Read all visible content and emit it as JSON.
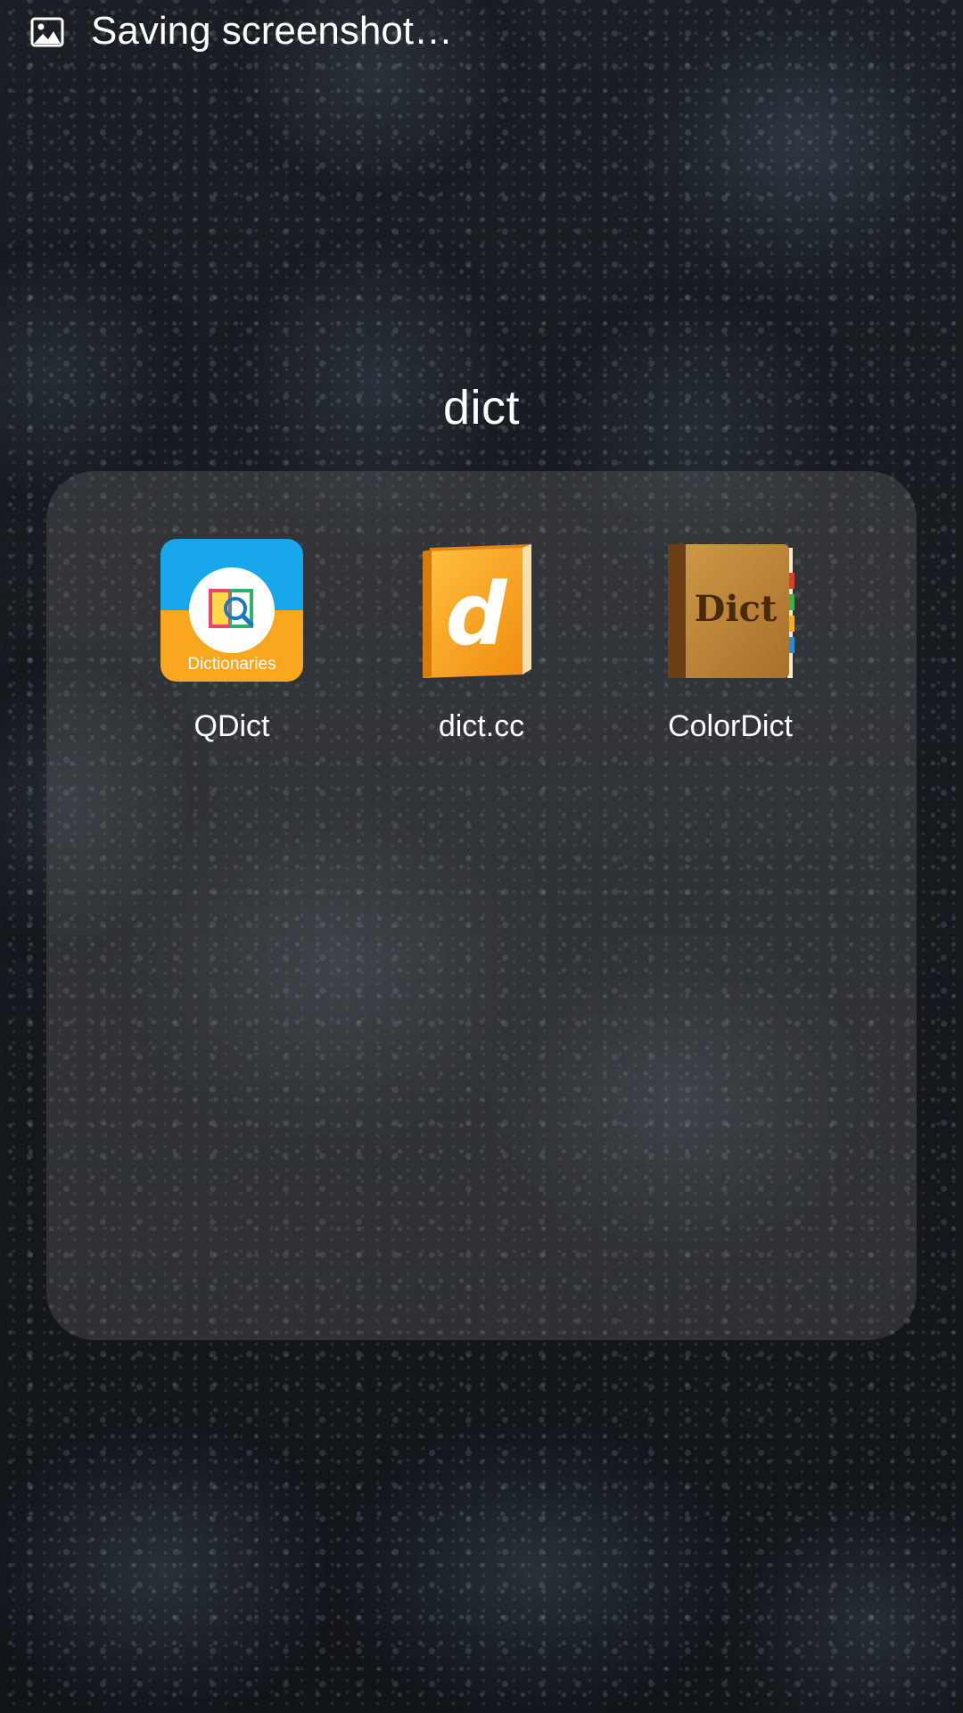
{
  "status_bar": {
    "notification_icon": "image-icon",
    "notification_text": "Saving screenshot…"
  },
  "folder": {
    "title": "dict",
    "apps": [
      {
        "label": "QDict",
        "icon": "qdict-icon",
        "icon_caption": "Dictionaries"
      },
      {
        "label": "dict.cc",
        "icon": "dictcc-icon",
        "icon_letter": "d"
      },
      {
        "label": "ColorDict",
        "icon": "colordict-icon",
        "icon_text": "Dict"
      }
    ]
  },
  "colors": {
    "qdict_top": "#17a7ea",
    "qdict_bottom": "#f9a71f",
    "dictcc_book": "#f7a623",
    "colordict_cover": "#c08a3a"
  }
}
